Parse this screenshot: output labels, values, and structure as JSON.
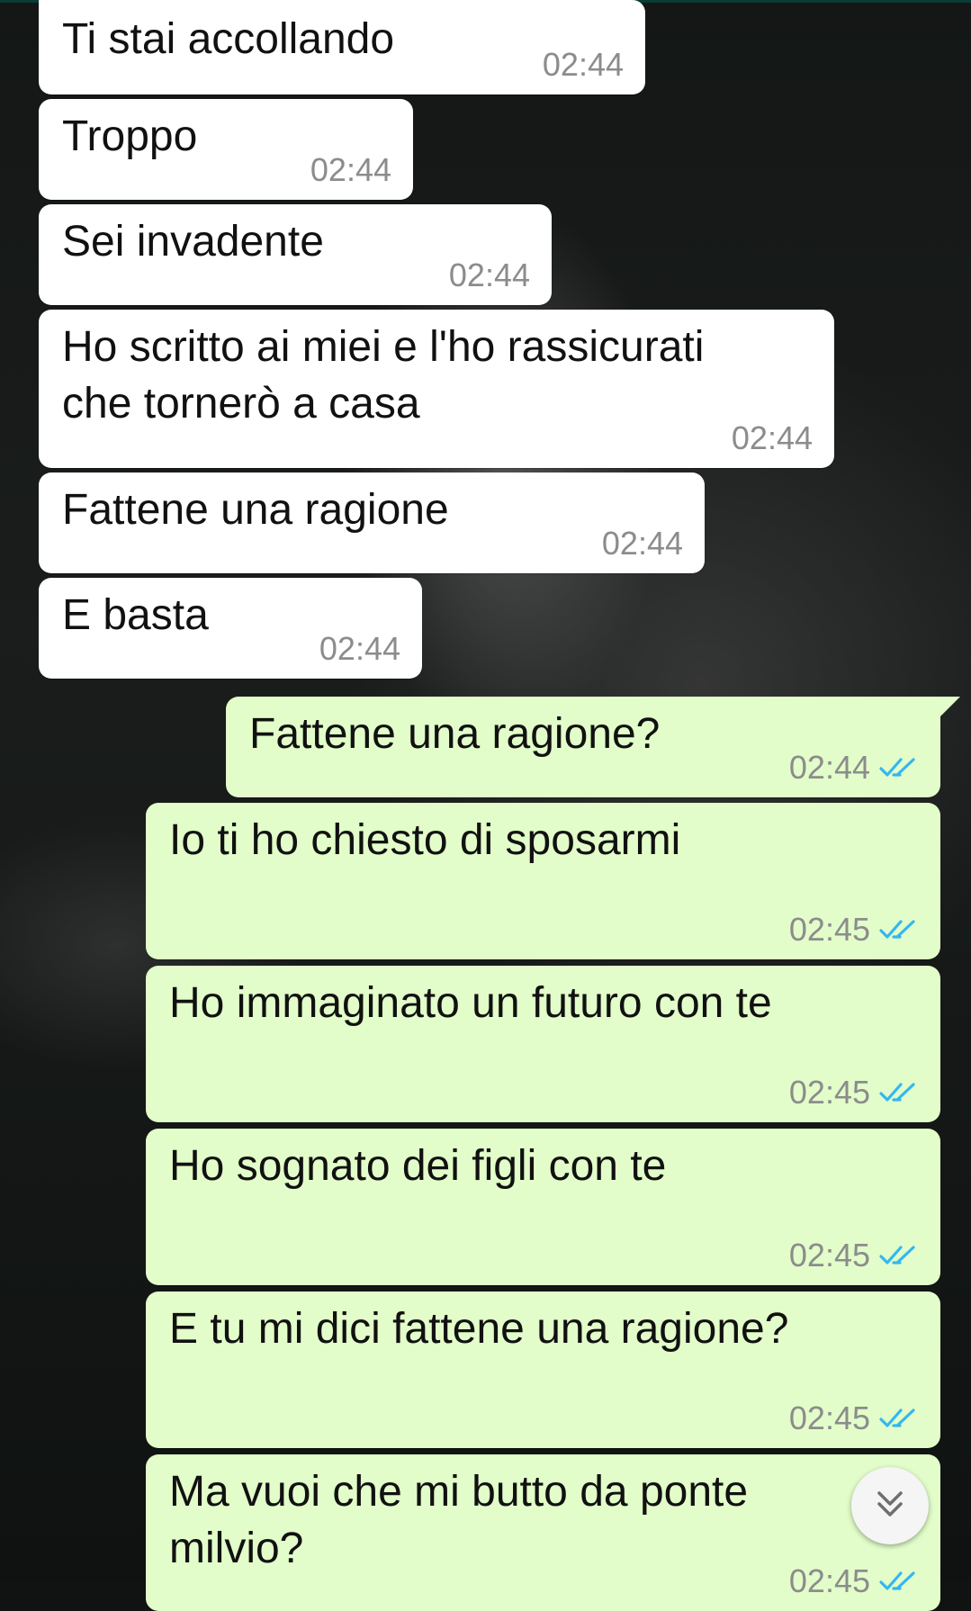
{
  "colors": {
    "incoming_bubble": "#ffffff",
    "outgoing_bubble": "#e2fdc9",
    "timestamp": "#8c8c8c",
    "read_tick": "#34b7f1"
  },
  "messages": [
    {
      "direction": "in",
      "text": "Ti stai accollando",
      "time": "02:44"
    },
    {
      "direction": "in",
      "text": "Troppo",
      "time": "02:44"
    },
    {
      "direction": "in",
      "text": "Sei invadente",
      "time": "02:44"
    },
    {
      "direction": "in",
      "text": "Ho scritto ai miei e l'ho rassicurati\nche tornerò a casa",
      "time": "02:44"
    },
    {
      "direction": "in",
      "text": "Fattene una ragione",
      "time": "02:44"
    },
    {
      "direction": "in",
      "text": "E basta",
      "time": "02:44"
    },
    {
      "direction": "out",
      "text": "Fattene una ragione?",
      "time": "02:44",
      "status": "read"
    },
    {
      "direction": "out",
      "text": "Io ti ho chiesto di sposarmi",
      "time": "02:45",
      "status": "read"
    },
    {
      "direction": "out",
      "text": "Ho immaginato un futuro con te",
      "time": "02:45",
      "status": "read"
    },
    {
      "direction": "out",
      "text": "Ho sognato dei figli con te",
      "time": "02:45",
      "status": "read"
    },
    {
      "direction": "out",
      "text": "E tu mi dici fattene una ragione?",
      "time": "02:45",
      "status": "read"
    },
    {
      "direction": "out",
      "text": "Ma vuoi che mi butto da ponte\nmilvio?",
      "time": "02:45",
      "status": "read"
    }
  ],
  "scroll_down_button": {
    "icon": "double-chevron-down-icon"
  }
}
